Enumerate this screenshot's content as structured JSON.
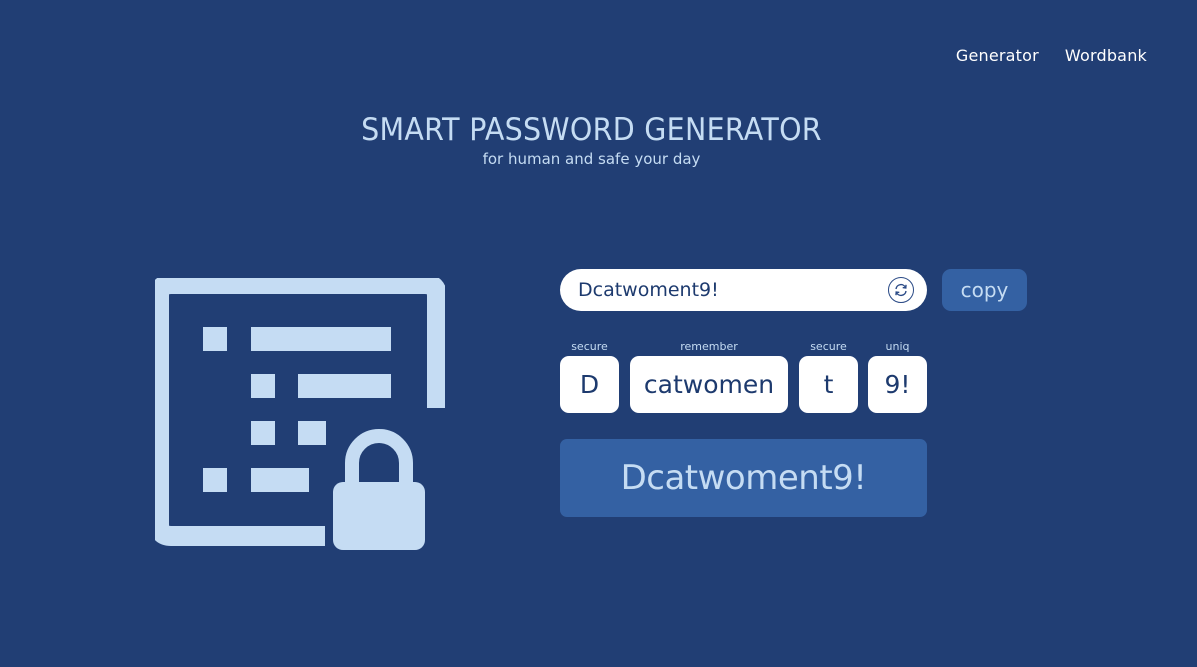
{
  "nav": {
    "items": [
      {
        "label": "Generator"
      },
      {
        "label": "Wordbank"
      }
    ]
  },
  "hero": {
    "title": "SMART PASSWORD GENERATOR",
    "subtitle": "for human and safe your day"
  },
  "generator": {
    "password_value": "Dcatwoment9!",
    "refresh_icon": "refresh-icon",
    "copy_label": "copy",
    "chunks": [
      {
        "label": "secure",
        "value": "D"
      },
      {
        "label": "remember",
        "value": "catwomen"
      },
      {
        "label": "secure",
        "value": "t"
      },
      {
        "label": "uniq",
        "value": "9!"
      }
    ],
    "result": "Dcatwoment9!"
  },
  "illustration_icon": "password-list-lock-icon",
  "colors": {
    "background": "#213e74",
    "accent_light": "#c5dcf3",
    "button": "#3461a3",
    "text_dark": "#1d3a6e"
  }
}
